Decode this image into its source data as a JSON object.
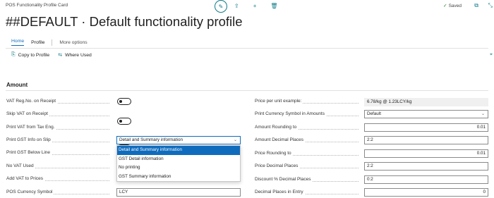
{
  "window": {
    "title": "POS Functionality Profile Card",
    "saved_label": "Saved"
  },
  "page": {
    "title": "##DEFAULT · Default functionality profile"
  },
  "tabs": [
    {
      "label": "Home"
    },
    {
      "label": "Profile"
    },
    {
      "label": "More options"
    }
  ],
  "actions": {
    "copy_to_profile": "Copy to Profile",
    "where_used": "Where Used"
  },
  "section": {
    "title": "Amount"
  },
  "left_fields": {
    "vat_reg_no": "VAT Reg.No. on Receipt",
    "skip_vat": "Skip VAT on Receipt",
    "print_vat_tax": "Print VAT from Tax Eng.",
    "print_gst_info": "Print GST Info on Slip",
    "print_gst_below": "Print GST Below Line",
    "no_vat_used": "No VAT Used",
    "add_vat_prices": "Add VAT to Prices",
    "pos_currency_symbol": "POS Currency Symbol"
  },
  "left_values": {
    "print_gst_info": "Detail and Summary information",
    "pos_currency_symbol": "LCY"
  },
  "dropdown_options": [
    "Detail and Summary information",
    "GST Detail information",
    "No printing",
    "GST Summary information"
  ],
  "right_fields": {
    "price_per_unit_example": "Price per unit example:",
    "print_currency_symbol": "Print Currency Symbol in Amounts",
    "amount_rounding": "Amount Rounding to",
    "amount_decimal_places": "Amount Decimal Places",
    "price_rounding": "Price Rounding to",
    "price_decimal_places": "Price Decimal Places",
    "discount_decimal_places": "Discount % Decimal Places",
    "decimal_places_entry": "Decimal Places in Entry"
  },
  "right_values": {
    "price_per_unit_example": "6.78/kg @ 1.23LCY/kg",
    "print_currency_symbol": "Default",
    "amount_rounding": "0.01",
    "amount_decimal_places": "2:2",
    "price_rounding": "0.01",
    "price_decimal_places": "2:2",
    "discount_decimal_places": "0:2",
    "decimal_places_entry": "0"
  },
  "toggles": {
    "vat_reg_no": false,
    "skip_vat": false,
    "print_vat_tax": false
  },
  "icons": {
    "edit": "pencil-icon",
    "share": "share-icon",
    "new": "plus-icon",
    "delete": "trash-icon",
    "saved": "checkmark-icon",
    "open_new": "open-in-new-window-icon",
    "collapse": "collapse-icon",
    "copy": "copy-icon",
    "where_used": "where-used-icon",
    "pin": "pin-icon"
  },
  "colors": {
    "accent": "#0f6cbd",
    "teal": "#0f7b87"
  }
}
